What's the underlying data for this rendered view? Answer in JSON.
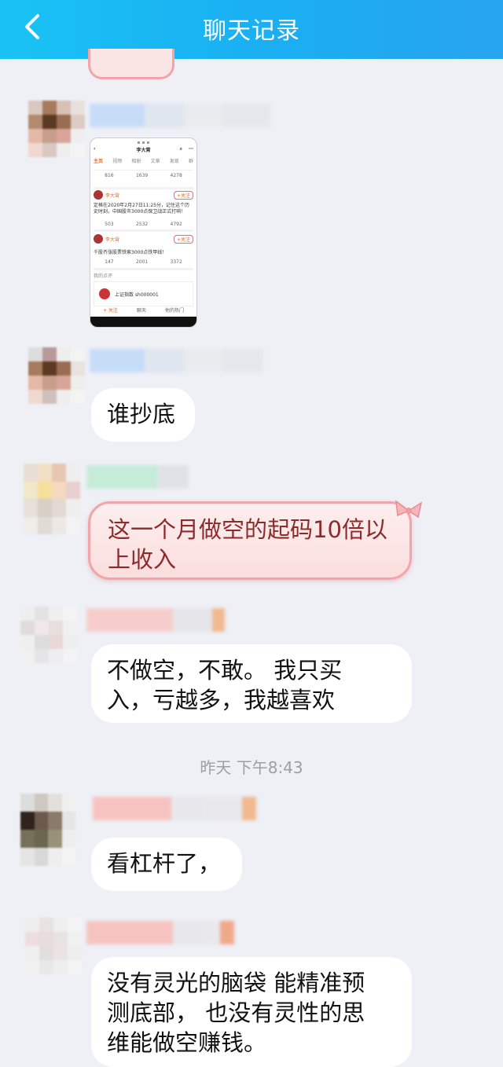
{
  "header": {
    "title": "聊天记录",
    "back_icon": "chevron-left-icon"
  },
  "shared_screenshot": {
    "user": "李大霄",
    "tabs": [
      "主页",
      "视频",
      "相册",
      "文章",
      "发现",
      "群"
    ],
    "stats": [
      "816",
      "1639",
      "4278"
    ],
    "post1": "定格在2020年2月27日11:25分，记住这个历史时刻，中国股市3000点保卫战正式打响！",
    "post1_stats": [
      "503",
      "2532",
      "4792"
    ],
    "post2": "千股齐涨股票铁索3000点铁甲线！",
    "post2_stats": [
      "147",
      "2001",
      "3372"
    ],
    "card_label": "我的点评",
    "card_title": "上证指数 sh000001"
  },
  "messages": [
    {
      "text": "谁抄底",
      "style": "white"
    },
    {
      "text": "这一个月做空的起码10倍以上收入",
      "style": "pink"
    },
    {
      "text": "不做空，不敢。 我只买入，亏越多，我越喜欢",
      "style": "white"
    },
    {
      "text": "看杠杆了，",
      "style": "white"
    },
    {
      "text": "没有灵光的脑袋 能精准预测底部， 也没有灵性的思维能做空赚钱。",
      "style": "white"
    }
  ],
  "timestamp": "昨天 下午8:43"
}
